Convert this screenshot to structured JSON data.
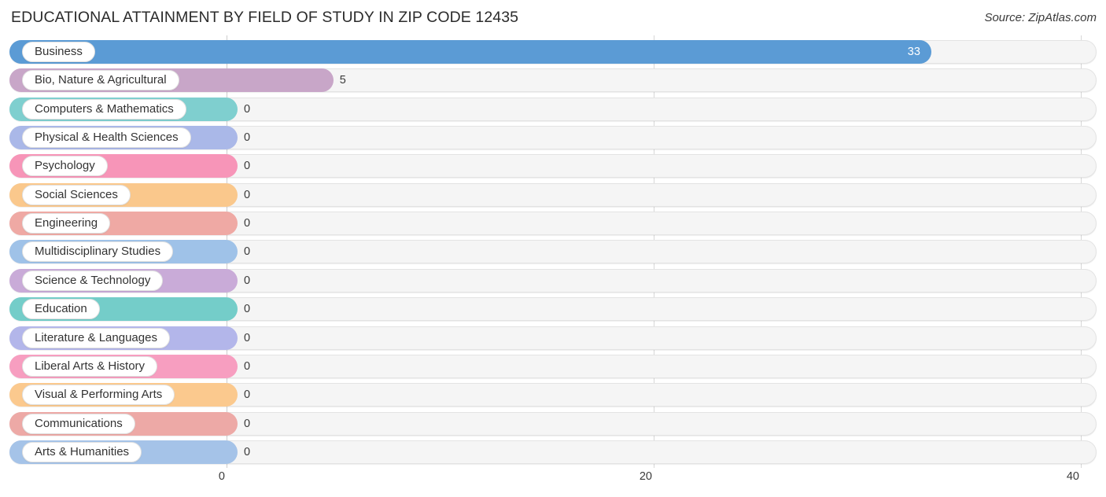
{
  "header": {
    "title": "EDUCATIONAL ATTAINMENT BY FIELD OF STUDY IN ZIP CODE 12435",
    "source": "Source: ZipAtlas.com"
  },
  "chart_data": {
    "type": "bar",
    "orientation": "horizontal",
    "title": "EDUCATIONAL ATTAINMENT BY FIELD OF STUDY IN ZIP CODE 12435",
    "xlabel": "",
    "ylabel": "",
    "xlim": [
      0,
      40
    ],
    "xticks": [
      0,
      20,
      40
    ],
    "xtick_labels": [
      "0",
      "20",
      "40"
    ],
    "grid": true,
    "legend": false,
    "categories": [
      "Business",
      "Bio, Nature & Agricultural",
      "Computers & Mathematics",
      "Physical & Health Sciences",
      "Psychology",
      "Social Sciences",
      "Engineering",
      "Multidisciplinary Studies",
      "Science & Technology",
      "Education",
      "Literature & Languages",
      "Liberal Arts & History",
      "Visual & Performing Arts",
      "Communications",
      "Arts & Humanities"
    ],
    "values": [
      33,
      5,
      0,
      0,
      0,
      0,
      0,
      0,
      0,
      0,
      0,
      0,
      0,
      0,
      0
    ],
    "value_labels": [
      "33",
      "5",
      "0",
      "0",
      "0",
      "0",
      "0",
      "0",
      "0",
      "0",
      "0",
      "0",
      "0",
      "0",
      "0"
    ],
    "colors": [
      "#5b9bd5",
      "#c8a6c8",
      "#7fcfcf",
      "#aab8e8",
      "#f795b8",
      "#fac88c",
      "#efa9a4",
      "#9fc2e8",
      "#c9abd8",
      "#74cdc9",
      "#b3b6ea",
      "#f79ec0",
      "#fbc98e",
      "#eda9a6",
      "#a5c3e8"
    ]
  }
}
